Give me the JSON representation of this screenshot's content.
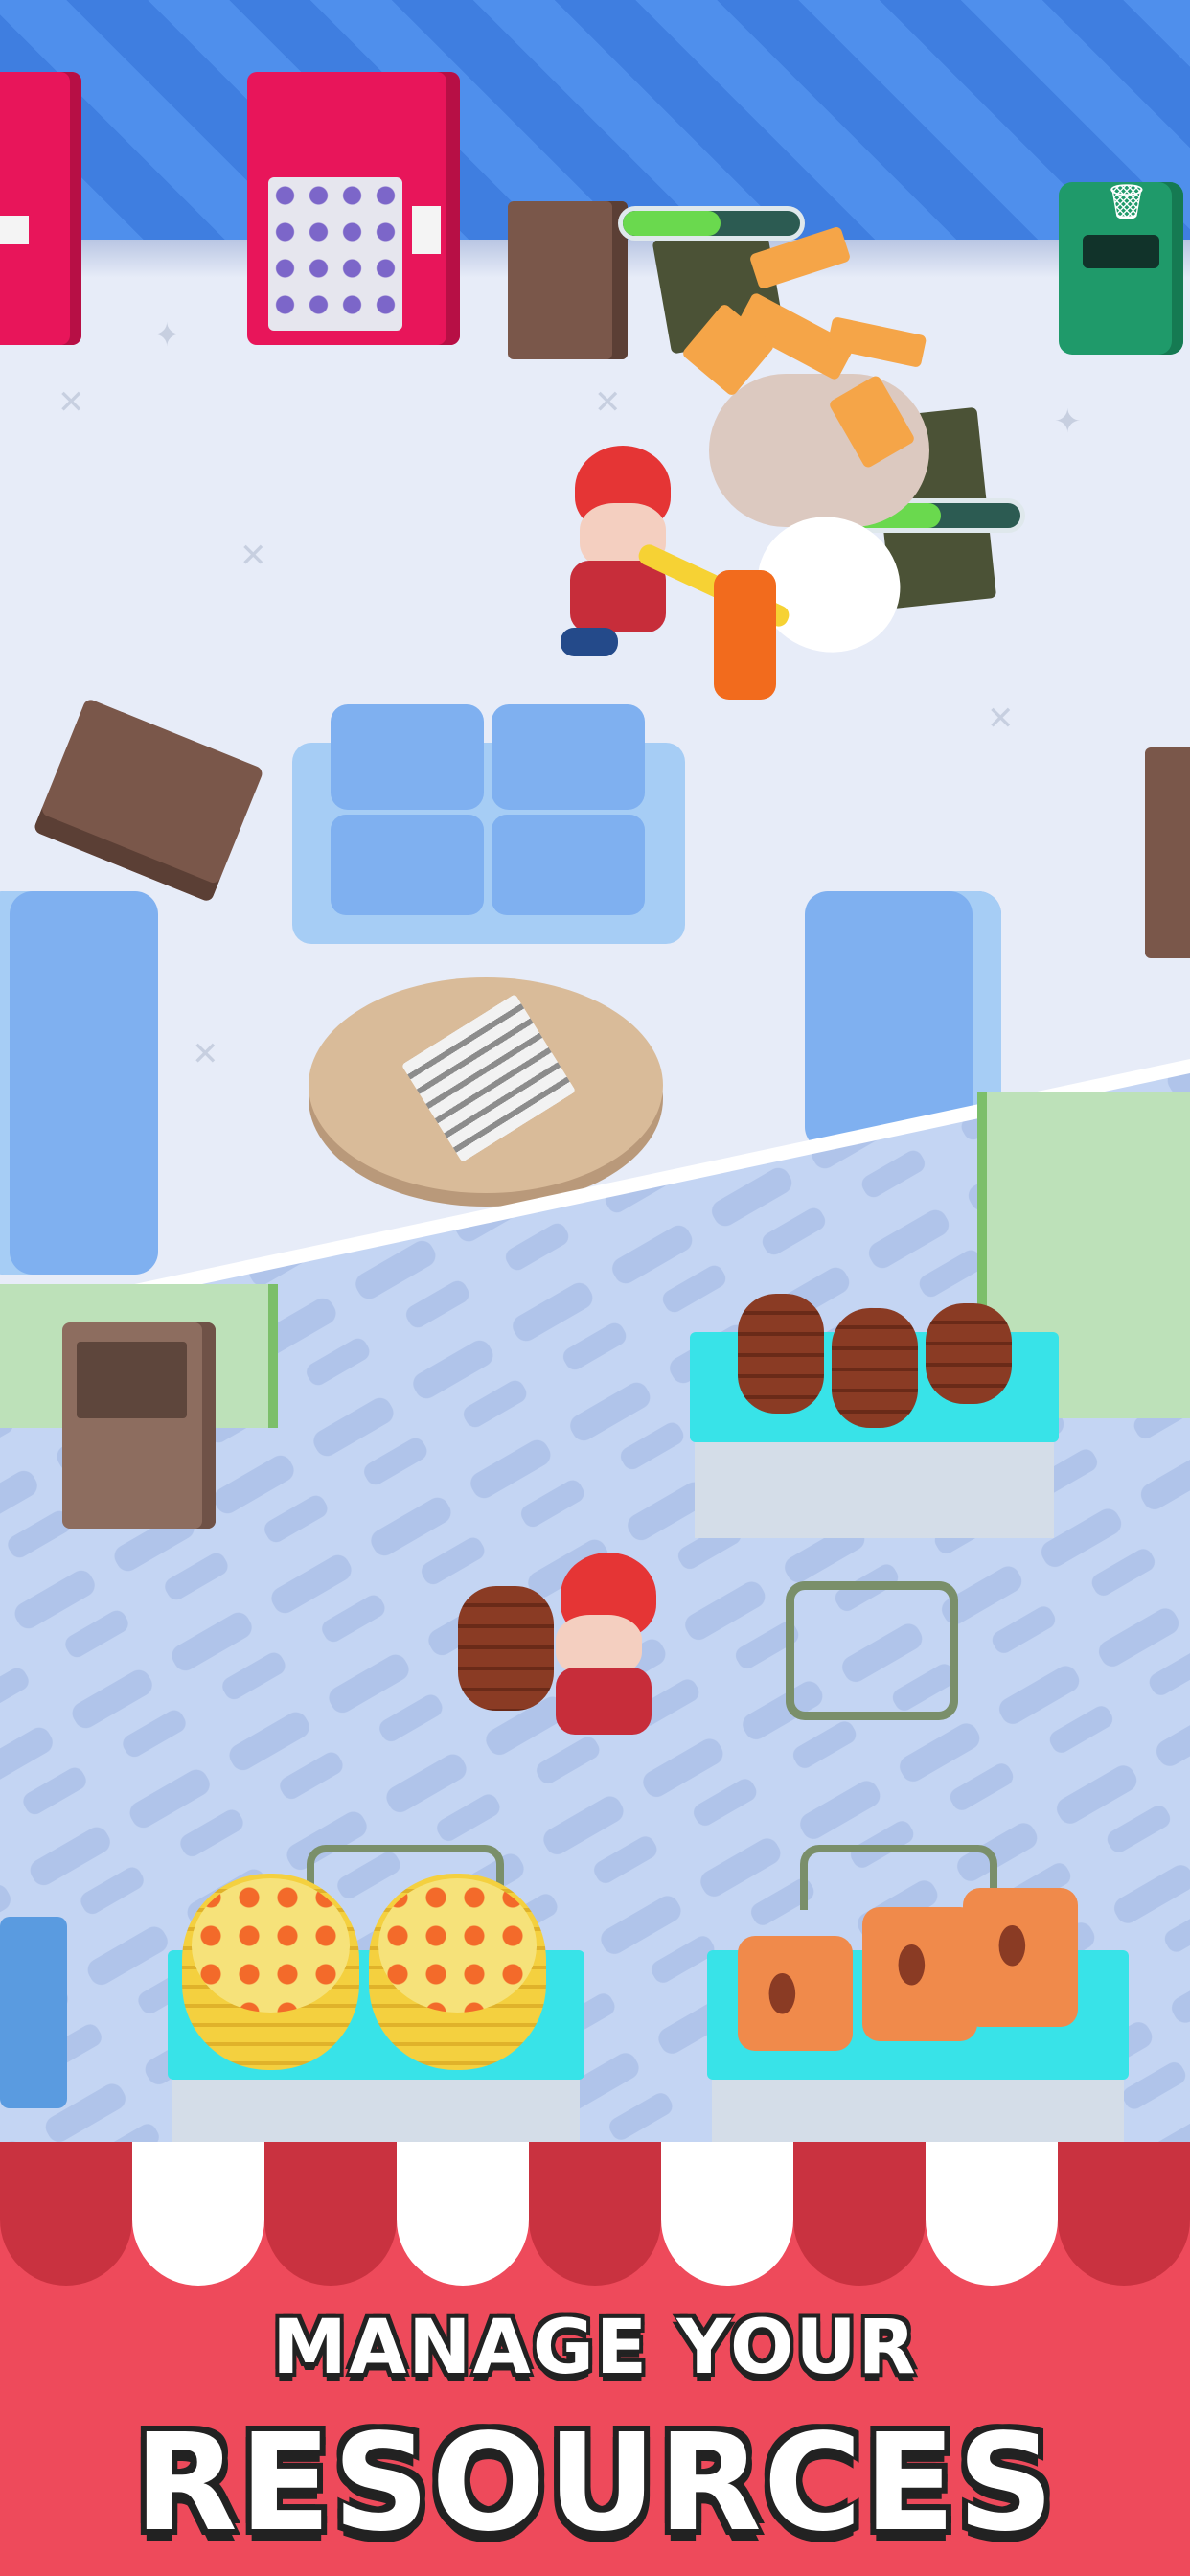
{
  "banner": {
    "line1": "MANAGE YOUR",
    "line2": "RESOURCES",
    "background_color": "#ee4a5b",
    "awning_colors": [
      "#c93240",
      "#ffffff"
    ]
  },
  "hud": {
    "progress_bars": [
      {
        "name": "crate-progress",
        "fraction": 0.55
      },
      {
        "name": "debris-progress",
        "fraction": 0.55
      }
    ]
  },
  "icons": {
    "trash": "trash-can-icon",
    "coffee": "coffee-bean-icon"
  },
  "colors": {
    "wall": "#3f7ee0",
    "sofa": "#7fb0f0",
    "counter": "#38e3e8",
    "vending_machine": "#e8155a",
    "trash_bin": "#1f9a6a"
  }
}
